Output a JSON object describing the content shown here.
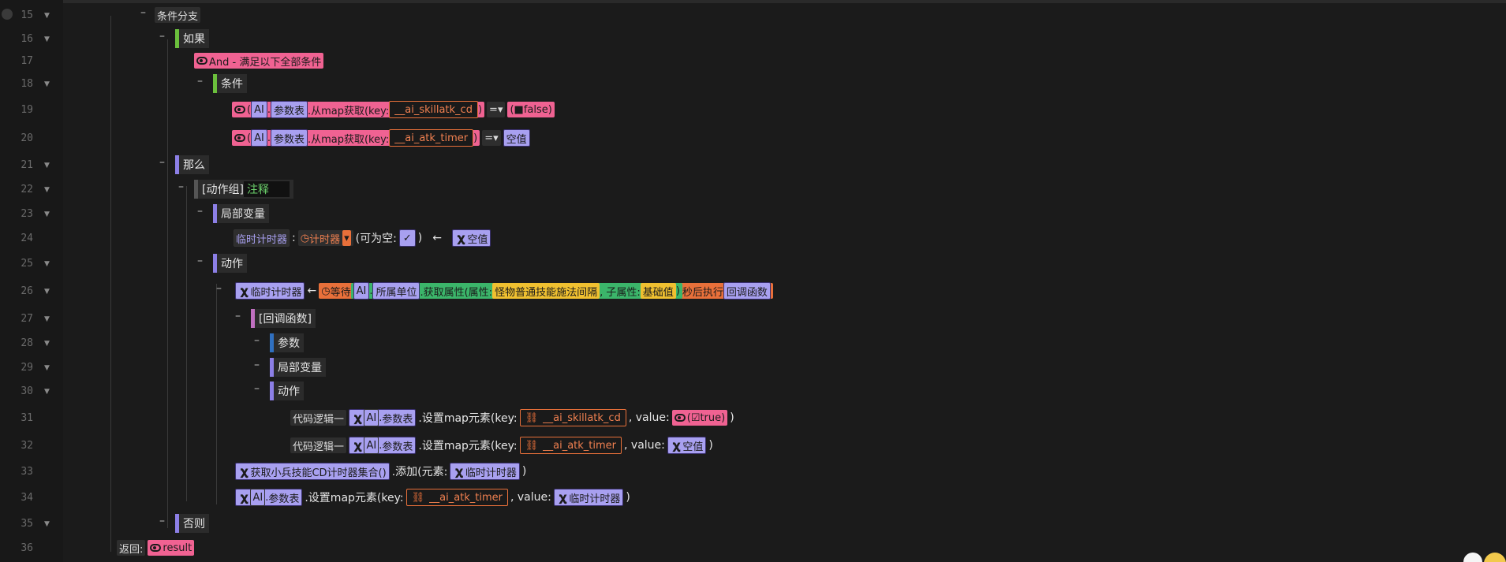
{
  "lines": [
    "15",
    "16",
    "17",
    "18",
    "19",
    "20",
    "21",
    "22",
    "23",
    "24",
    "25",
    "26",
    "27",
    "28",
    "29",
    "30",
    "31",
    "32",
    "33",
    "34",
    "35",
    "36"
  ],
  "labels": {
    "branch": "条件分支",
    "if": "如果",
    "and": "And - 满足以下全部条件",
    "conditions": "条件",
    "then": "那么",
    "action_group": "[动作组]",
    "note": "注释",
    "local_vars": "局部变量",
    "actions": "动作",
    "callback": "[回调函数]",
    "params": "参数",
    "else": "否则",
    "return": "返回:",
    "result": "result"
  },
  "cond1": {
    "ai": "AI",
    "table": "参数表",
    "method": ".从map获取(key:",
    "key": "__ai_skillatk_cd",
    "op": "=",
    "val": "false"
  },
  "cond2": {
    "ai": "AI",
    "table": "参数表",
    "method": ".从map获取(key:",
    "key": "__ai_atk_timer",
    "op": "=",
    "val": "空值"
  },
  "var24": {
    "name": "临时计时器",
    "type": "计时器",
    "nullable": "(可为空:",
    "arrow": "←",
    "val": "空值"
  },
  "line26": {
    "var": "临时计时器",
    "arrow": "←",
    "wait": "等待",
    "ai": "AI",
    "unit": "所属单位",
    "get": ".获取属性(属性:",
    "attr": "怪物普通技能施法间隔",
    "sub": ", 子属性:",
    "subval": "基础值",
    "after": "秒后执行",
    "cb": "回调函数"
  },
  "line31": {
    "code": "代码逻辑一",
    "ai": "AI",
    "table": "参数表",
    "method": ".设置map元素(key:",
    "key": "__ai_skillatk_cd",
    "value": ", value:",
    "val": "true"
  },
  "line32": {
    "code": "代码逻辑一",
    "ai": "AI",
    "table": "参数表",
    "method": ".设置map元素(key:",
    "key": "__ai_atk_timer",
    "value": ", value:",
    "val": "空值"
  },
  "line33": {
    "fn": "获取小兵技能CD计时器集合()",
    "add": ".添加(元素:",
    "el": "临时计时器"
  },
  "line34": {
    "ai": "AI",
    "table": "参数表",
    "method": ".设置map元素(key:",
    "key": "__ai_atk_timer",
    "value": ", value:",
    "val": "临时计时器"
  }
}
